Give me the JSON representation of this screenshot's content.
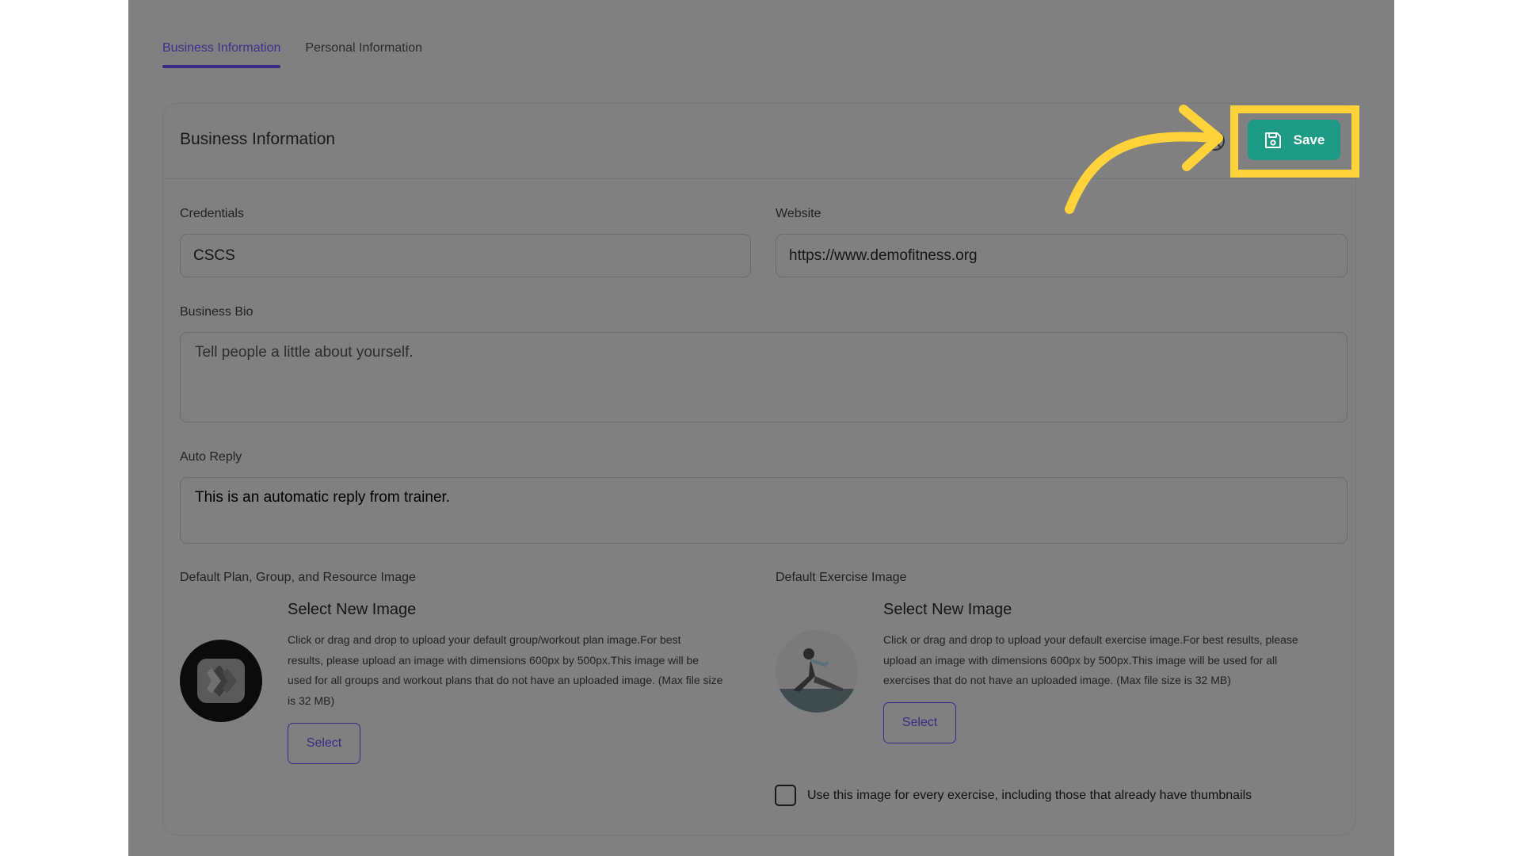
{
  "tabs": [
    {
      "label": "Business Information"
    },
    {
      "label": "Personal Information"
    }
  ],
  "card": {
    "title": "Business Information",
    "save_label": "Save"
  },
  "fields": {
    "credentials": {
      "label": "Credentials",
      "value": "CSCS"
    },
    "website": {
      "label": "Website",
      "value": "https://www.demofitness.org"
    },
    "bio": {
      "label": "Business Bio",
      "placeholder": "Tell people a little about yourself."
    },
    "auto_reply": {
      "label": "Auto Reply",
      "value": "This is an automatic reply from trainer."
    }
  },
  "default_plan_image": {
    "label": "Default Plan, Group, and Resource Image",
    "title": "Select New Image",
    "desc_lines": [
      "Click or drag and drop to upload your default group/workout plan image.For best",
      "results, please upload an image with dimensions 600px by 500px.This image will be",
      "used for all groups and workout plans that do not have an uploaded image. (Max file size",
      "is 32 MB)"
    ],
    "button": "Select"
  },
  "default_exercise_image": {
    "label": "Default Exercise Image",
    "title": "Select New Image",
    "desc_lines": [
      "Click or drag and drop to upload your default exercise image.For best results, please",
      "upload an image with dimensions 600px by 500px.This image will be used for all",
      "exercises that do not have an uploaded image. (Max file size is 32 MB)"
    ],
    "button": "Select"
  },
  "use_for_all": {
    "label": "Use this image for every exercise, including those that already have thumbnails",
    "checked": false
  },
  "colors": {
    "overlay": "#808080",
    "accent": "#3b2a84",
    "save": "#1c9a83",
    "highlight": "#ffd23a"
  },
  "icons": [
    "spinner-icon",
    "save-icon",
    "arrow-annotation",
    "checkbox"
  ]
}
